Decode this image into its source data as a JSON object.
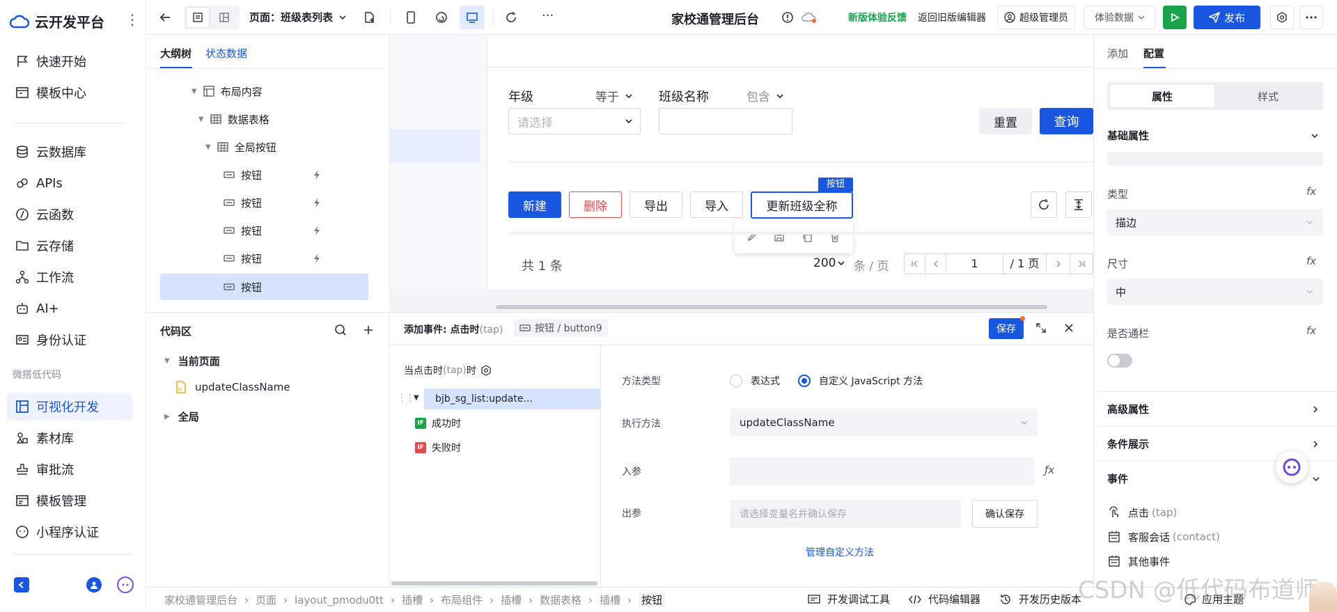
{
  "app": {
    "logo_text": "云开发平台",
    "more": "⋮"
  },
  "nav": {
    "items": [
      {
        "label": "快速开始",
        "icon": "flag-icon"
      },
      {
        "label": "模板中心",
        "icon": "template-icon"
      },
      {
        "label": "云数据库",
        "icon": "database-icon"
      },
      {
        "label": "APIs",
        "icon": "api-icon"
      },
      {
        "label": "云函数",
        "icon": "function-icon"
      },
      {
        "label": "云存储",
        "icon": "folder-icon"
      },
      {
        "label": "工作流",
        "icon": "workflow-icon"
      },
      {
        "label": "AI+",
        "icon": "robot-icon"
      },
      {
        "label": "身份认证",
        "icon": "id-card-icon"
      }
    ],
    "section_title": "微搭低代码",
    "lowcode_items": [
      {
        "label": "可视化开发",
        "icon": "layout-icon",
        "active": true
      },
      {
        "label": "素材库",
        "icon": "assets-icon"
      },
      {
        "label": "审批流",
        "icon": "approval-icon"
      },
      {
        "label": "模板管理",
        "icon": "template-manage-icon"
      },
      {
        "label": "小程序认证",
        "icon": "miniprogram-icon"
      }
    ]
  },
  "topbar": {
    "page_label": "页面：班级表列表",
    "title": "家校通管理后台",
    "feedback": "新版体验反馈",
    "return_old": "返回旧版编辑器",
    "admin": "超级管理员",
    "exp_data": "体验数据",
    "publish": "发布",
    "more": "···"
  },
  "outline": {
    "tabs": [
      "大纲树",
      "状态数据"
    ],
    "rows": [
      {
        "label": "布局内容"
      },
      {
        "label": "数据表格"
      },
      {
        "label": "全局按钮"
      },
      {
        "label": "按钮"
      },
      {
        "label": "按钮"
      },
      {
        "label": "按钮"
      },
      {
        "label": "按钮"
      },
      {
        "label": "按钮"
      }
    ]
  },
  "code": {
    "title": "代码区",
    "current_page": "当前页面",
    "file": "updateClassName",
    "global": "全局"
  },
  "canvas": {
    "grade_label": "年级",
    "grade_op": "等于",
    "grade_placeholder": "请选择",
    "class_label": "班级名称",
    "class_op": "包含",
    "reset": "重置",
    "query": "查询",
    "new": "新建",
    "delete": "删除",
    "export": "导出",
    "import": "导入",
    "update": "更新班级全称",
    "badge": "按钮",
    "total": "共 1 条",
    "page_size": "200",
    "per_page": "条 / 页",
    "page_num": "1",
    "page_total": "/ 1 页"
  },
  "event": {
    "title": "添加事件: 点击时",
    "title_tap": "(tap)",
    "component": "按钮 / button9",
    "save": "保存",
    "trigger": "当点击时",
    "trigger_tap": "(tap)",
    "trigger_suffix": "时",
    "action": "bjb_sg_list:update...",
    "success": "成功时",
    "fail": "失败时",
    "method_type_label": "方法类型",
    "opt_expr": "表达式",
    "opt_js": "自定义 JavaScript 方法",
    "exec_label": "执行方法",
    "exec_value": "updateClassName",
    "in_label": "入参",
    "out_label": "出参",
    "out_placeholder": "请选择变量名并确认保存",
    "confirm_save": "确认保存",
    "manage": "管理自定义方法"
  },
  "props": {
    "tabs": [
      "添加",
      "配置"
    ],
    "seg": [
      "属性",
      "样式"
    ],
    "basic": "基础属性",
    "type_label": "类型",
    "type_value": "描边",
    "size_label": "尺寸",
    "size_value": "中",
    "full_label": "是否通栏",
    "fx": "fx",
    "advanced": "高级属性",
    "conditional": "条件展示",
    "events": "事件",
    "ev_items": [
      {
        "label": "点击",
        "tag": "(tap)"
      },
      {
        "label": "客服会话",
        "tag": "(contact)"
      },
      {
        "label": "其他事件",
        "tag": ""
      }
    ]
  },
  "breadcrumb": [
    "家校通管理后台",
    "页面",
    "layout_pmodu0tt",
    "插槽",
    "布局组件",
    "插槽",
    "数据表格",
    "插槽",
    "按钮"
  ],
  "footer": {
    "debug": "开发调试工具",
    "code_editor": "代码编辑器",
    "history": "开发历史版本",
    "theme": "应用主题",
    "watermark": "CSDN @低代码布道师"
  },
  "colors": {
    "primary": "#1957e0",
    "green": "#19a34a",
    "danger": "#e5484d"
  }
}
